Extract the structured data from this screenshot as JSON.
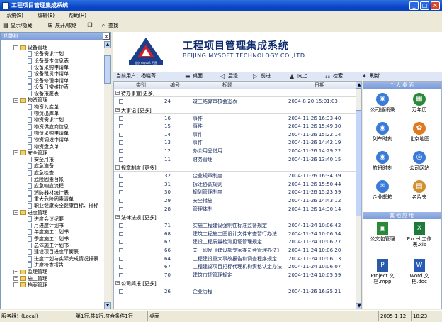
{
  "window": {
    "title": "工程项目管理集成系统"
  },
  "menu": [
    "系统(S)",
    "编辑(E)",
    "帮助(H)"
  ],
  "toolbar": {
    "show_hide": "显示/隐藏",
    "expand_collapse": "展开/收缩",
    "search": "查找"
  },
  "left_panel": {
    "title": "功能树",
    "tree": [
      {
        "label": "设备管理",
        "level": 0,
        "expanded": true
      },
      {
        "label": "设备需求计划",
        "level": 1
      },
      {
        "label": "设备基本信息表",
        "level": 1
      },
      {
        "label": "设备采购申请单",
        "level": 1
      },
      {
        "label": "设备租赁申请单",
        "level": 1
      },
      {
        "label": "设备修理申请单",
        "level": 1
      },
      {
        "label": "设备日常维护表",
        "level": 1
      },
      {
        "label": "设备报废表",
        "level": 1
      },
      {
        "label": "物资管理",
        "level": 0,
        "expanded": true
      },
      {
        "label": "物资入库单",
        "level": 1
      },
      {
        "label": "物资出库单",
        "level": 1
      },
      {
        "label": "物资需求计划",
        "level": 1
      },
      {
        "label": "物资供应商信息",
        "level": 1
      },
      {
        "label": "物资采购申请单",
        "level": 1
      },
      {
        "label": "物资调拨申请单",
        "level": 1
      },
      {
        "label": "物资盘点单",
        "level": 1
      },
      {
        "label": "安全管理",
        "level": 0,
        "expanded": true
      },
      {
        "label": "安全月报",
        "level": 1
      },
      {
        "label": "应急准备",
        "level": 1
      },
      {
        "label": "应急检查",
        "level": 1
      },
      {
        "label": "危险因素台帐",
        "level": 1
      },
      {
        "label": "应急响应流程",
        "level": 1
      },
      {
        "label": "消防器材统计表",
        "level": 1
      },
      {
        "label": "重大危险因素清单",
        "level": 1
      },
      {
        "label": "职业健康安全健康目标、指标",
        "level": 1
      },
      {
        "label": "进度管理",
        "level": 0,
        "expanded": true
      },
      {
        "label": "进度会议纪要",
        "level": 1
      },
      {
        "label": "月进度计划书",
        "level": 1
      },
      {
        "label": "年度施工计划书",
        "level": 1
      },
      {
        "label": "季度施工计划书",
        "level": 1
      },
      {
        "label": "总体施工计划书",
        "level": 1
      },
      {
        "label": "建设项目进度平衡表",
        "level": 1
      },
      {
        "label": "进度计划与实际完成情况报表",
        "level": 1
      },
      {
        "label": "进度检查报告",
        "level": 1
      },
      {
        "label": "监理管理",
        "level": 0,
        "expanded": false
      },
      {
        "label": "施工管理",
        "level": 0,
        "expanded": false
      },
      {
        "label": "档案管理",
        "level": 0,
        "expanded": false
      }
    ]
  },
  "banner": {
    "title": "工程项目管理集成系统",
    "subtitle": "BEIJING MYSOFT TECHNOLOGY CO.,LTD",
    "logo_text": "北京 mysoft 万图"
  },
  "userbar": {
    "user_label": "当前用户：杨晓菁",
    "desktop": "桌面",
    "back": "后退",
    "forward": "前进",
    "up": "向上",
    "search": "检索",
    "refresh": "刷新"
  },
  "table": {
    "headers": [
      "类别",
      "编号",
      "标题",
      "日期"
    ],
    "groups": [
      {
        "label": "待办事宜[更多]",
        "rows": [
          {
            "no": "24",
            "title": "竣工结算审核会签表",
            "date": "2004-8-20 15:01:03"
          }
        ]
      },
      {
        "label": "大事记 [更多]",
        "rows": [
          {
            "no": "16",
            "title": "事件",
            "date": "2004-11-26 16:33:40"
          },
          {
            "no": "15",
            "title": "事件",
            "date": "2004-11-26 15:49:30"
          },
          {
            "no": "14",
            "title": "事件",
            "date": "2004-11-26 15:22:14"
          },
          {
            "no": "13",
            "title": "事件",
            "date": "2004-11-26 14:42:19"
          },
          {
            "no": "12",
            "title": "办公用品借用",
            "date": "2004-11-26 14:29:22"
          },
          {
            "no": "11",
            "title": "财务管理",
            "date": "2004-11-26 13:40:15"
          }
        ]
      },
      {
        "label": "规章制度 [更多]",
        "rows": [
          {
            "no": "32",
            "title": "企业规章制度",
            "date": "2004-11-26 16:34:39"
          },
          {
            "no": "31",
            "title": "拆迁协调规则",
            "date": "2004-11-26 15:50:44"
          },
          {
            "no": "30",
            "title": "规划管理制度",
            "date": "2004-11-26 15:23:59"
          },
          {
            "no": "29",
            "title": "安全措施",
            "date": "2004-11-26 14:43:12"
          },
          {
            "no": "28",
            "title": "管理体制",
            "date": "2004-11-26 14:30:14"
          }
        ]
      },
      {
        "label": "法律法规 [更多]",
        "rows": [
          {
            "no": "71",
            "title": "实施工程建设强制性标准监督规定",
            "date": "2004-11-24 10:06:42"
          },
          {
            "no": "68",
            "title": "建筑工程施工图设计文件审查暂行办法",
            "date": "2004-11-24 10:06:34"
          },
          {
            "no": "67",
            "title": "建设工程质量检测见证管理规定",
            "date": "2004-11-24 10:06:27"
          },
          {
            "no": "66",
            "title": "关于印发《建设部专家委员会管理办法》",
            "date": "2004-11-24 10:06:20"
          },
          {
            "no": "64",
            "title": "工程建设重大事故报告和调查程序规定",
            "date": "2004-11-24 10:06:13"
          },
          {
            "no": "67",
            "title": "工程建设项目招标代理机构资格认定办法",
            "date": "2004-11-24 10:06:07"
          },
          {
            "no": "70",
            "title": "建筑市场管理规定",
            "date": "2004-11-24 10:05:59"
          }
        ]
      },
      {
        "label": "公司简报 [更多]",
        "rows": [
          {
            "no": "26",
            "title": "企业历程",
            "date": "2004-11-26 16:35:21"
          }
        ]
      }
    ]
  },
  "right_panel": {
    "desktop_title": "个人桌面",
    "desktop_items": [
      {
        "label": "公司通讯录",
        "icon": "globe-icon",
        "color": "#3a7ad8"
      },
      {
        "label": "万年历",
        "icon": "calendar-icon",
        "color": "#2a8a3a"
      },
      {
        "label": "列车时刻",
        "icon": "train-icon",
        "color": "#3a7ad8"
      },
      {
        "label": "北京地图",
        "icon": "map-icon",
        "color": "#e07a20"
      },
      {
        "label": "航班时刻",
        "icon": "plane-icon",
        "color": "#3a7ad8"
      },
      {
        "label": "公司网站",
        "icon": "website-icon",
        "color": "#3a7ad8"
      },
      {
        "label": "企业邮箱",
        "icon": "mail-icon",
        "color": "#3a7ad8"
      },
      {
        "label": "名片夹",
        "icon": "card-icon",
        "color": "#d09030"
      }
    ],
    "apps_title": "其他应用",
    "app_items": [
      {
        "label": "公文包管理",
        "icon": "briefcase-icon",
        "color": "#2a8a3a"
      },
      {
        "label": "Excel 工作表.xls",
        "icon": "excel-icon",
        "color": "#1d7a3a"
      },
      {
        "label": "Project 文档.mpp",
        "icon": "project-icon",
        "color": "#2a5aa8"
      },
      {
        "label": "Word 文档.doc",
        "icon": "word-icon",
        "color": "#2a5ab8"
      }
    ]
  },
  "status": {
    "server": "服务器：(Local)",
    "records": "第1行,共1行,符合条件1行",
    "location": "桌面",
    "date": "2005-1-12",
    "time": "18:23"
  }
}
